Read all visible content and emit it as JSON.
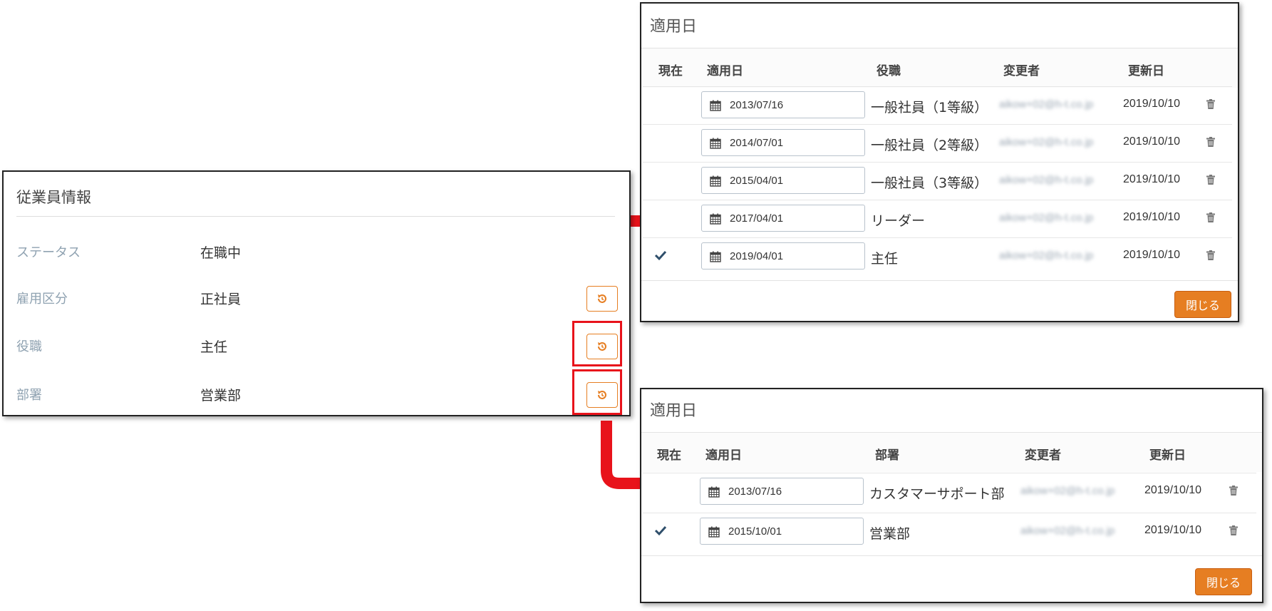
{
  "employee": {
    "title": "従業員情報",
    "rows": [
      {
        "label": "ステータス",
        "value": "在職中"
      },
      {
        "label": "雇用区分",
        "value": "正社員"
      },
      {
        "label": "役職",
        "value": "主任"
      },
      {
        "label": "部署",
        "value": "営業部"
      }
    ]
  },
  "position_history": {
    "title": "適用日",
    "headers": {
      "current": "現在",
      "date": "適用日",
      "item": "役職",
      "changer": "変更者",
      "updated": "更新日"
    },
    "rows": [
      {
        "date": "2013/07/16",
        "item": "一般社員（1等級）",
        "changer": "aikow+02@h-t.co.jp",
        "updated": "2019/10/10",
        "current": false
      },
      {
        "date": "2014/07/01",
        "item": "一般社員（2等級）",
        "changer": "aikow+02@h-t.co.jp",
        "updated": "2019/10/10",
        "current": false
      },
      {
        "date": "2015/04/01",
        "item": "一般社員（3等級）",
        "changer": "aikow+02@h-t.co.jp",
        "updated": "2019/10/10",
        "current": false
      },
      {
        "date": "2017/04/01",
        "item": "リーダー",
        "changer": "aikow+02@h-t.co.jp",
        "updated": "2019/10/10",
        "current": false
      },
      {
        "date": "2019/04/01",
        "item": "主任",
        "changer": "aikow+02@h-t.co.jp",
        "updated": "2019/10/10",
        "current": true
      }
    ],
    "close_label": "閉じる"
  },
  "department_history": {
    "title": "適用日",
    "headers": {
      "current": "現在",
      "date": "適用日",
      "item": "部署",
      "changer": "変更者",
      "updated": "更新日"
    },
    "rows": [
      {
        "date": "2013/07/16",
        "item": "カスタマーサポート部",
        "changer": "aikow+02@h-t.co.jp",
        "updated": "2019/10/10",
        "current": false
      },
      {
        "date": "2015/10/01",
        "item": "営業部",
        "changer": "aikow+02@h-t.co.jp",
        "updated": "2019/10/10",
        "current": true
      }
    ],
    "close_label": "閉じる"
  },
  "colors": {
    "accent": "#e67e22",
    "highlight": "#e8131b",
    "label": "#8fa2b1"
  },
  "icons": {
    "history": "history-icon",
    "calendar": "calendar-icon",
    "trash": "trash-icon",
    "check": "check-icon"
  }
}
